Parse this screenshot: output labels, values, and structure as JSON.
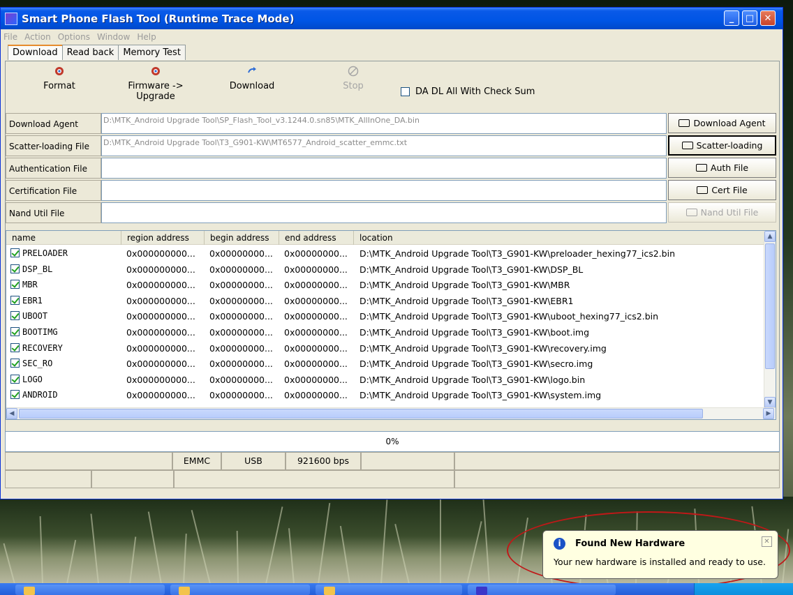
{
  "window": {
    "title": "Smart Phone Flash Tool (Runtime Trace Mode)",
    "controls": {
      "minimize": "_",
      "maximize": "□",
      "close": "✕"
    }
  },
  "menu": [
    "File",
    "Action",
    "Options",
    "Window",
    "Help"
  ],
  "tabs": [
    "Download",
    "Read back",
    "Memory Test"
  ],
  "toolbar": {
    "format": "Format",
    "firmware_upgrade": "Firmware -> Upgrade",
    "download": "Download",
    "stop": "Stop",
    "checksum_label": "DA DL All With Check Sum"
  },
  "files": [
    {
      "label": "Download Agent",
      "value": "D:\\MTK_Android Upgrade Tool\\SP_Flash_Tool_v3.1244.0.sn85\\MTK_AllInOne_DA.bin",
      "button": "Download Agent"
    },
    {
      "label": "Scatter-loading File",
      "value": "D:\\MTK_Android Upgrade Tool\\T3_G901-KW\\MT6577_Android_scatter_emmc.txt",
      "button": "Scatter-loading"
    },
    {
      "label": "Authentication File",
      "value": "",
      "button": "Auth File"
    },
    {
      "label": "Certification File",
      "value": "",
      "button": "Cert File"
    },
    {
      "label": "Nand Util File",
      "value": "",
      "button": "Nand Util File"
    }
  ],
  "list": {
    "headers": [
      "name",
      "region address",
      "begin address",
      "end address",
      "location"
    ],
    "rows": [
      {
        "name": "PRELOADER",
        "region": "0x000000000...",
        "begin": "0x00000000...",
        "end": "0x00000000...",
        "location": "D:\\MTK_Android Upgrade Tool\\T3_G901-KW\\preloader_hexing77_ics2.bin"
      },
      {
        "name": "DSP_BL",
        "region": "0x000000000...",
        "begin": "0x00000000...",
        "end": "0x00000000...",
        "location": "D:\\MTK_Android Upgrade Tool\\T3_G901-KW\\DSP_BL"
      },
      {
        "name": "MBR",
        "region": "0x000000000...",
        "begin": "0x00000000...",
        "end": "0x00000000...",
        "location": "D:\\MTK_Android Upgrade Tool\\T3_G901-KW\\MBR"
      },
      {
        "name": "EBR1",
        "region": "0x000000000...",
        "begin": "0x00000000...",
        "end": "0x00000000...",
        "location": "D:\\MTK_Android Upgrade Tool\\T3_G901-KW\\EBR1"
      },
      {
        "name": "UBOOT",
        "region": "0x000000000...",
        "begin": "0x00000000...",
        "end": "0x00000000...",
        "location": "D:\\MTK_Android Upgrade Tool\\T3_G901-KW\\uboot_hexing77_ics2.bin"
      },
      {
        "name": "BOOTIMG",
        "region": "0x000000000...",
        "begin": "0x00000000...",
        "end": "0x00000000...",
        "location": "D:\\MTK_Android Upgrade Tool\\T3_G901-KW\\boot.img"
      },
      {
        "name": "RECOVERY",
        "region": "0x000000000...",
        "begin": "0x00000000...",
        "end": "0x00000000...",
        "location": "D:\\MTK_Android Upgrade Tool\\T3_G901-KW\\recovery.img"
      },
      {
        "name": "SEC_RO",
        "region": "0x000000000...",
        "begin": "0x00000000...",
        "end": "0x00000000...",
        "location": "D:\\MTK_Android Upgrade Tool\\T3_G901-KW\\secro.img"
      },
      {
        "name": "LOGO",
        "region": "0x000000000...",
        "begin": "0x00000000...",
        "end": "0x00000000...",
        "location": "D:\\MTK_Android Upgrade Tool\\T3_G901-KW\\logo.bin"
      },
      {
        "name": "ANDROID",
        "region": "0x000000000...",
        "begin": "0x00000000...",
        "end": "0x00000000...",
        "location": "D:\\MTK_Android Upgrade Tool\\T3_G901-KW\\system.img"
      }
    ]
  },
  "progress": {
    "text": "0%",
    "value": 0
  },
  "status": {
    "storage": "EMMC",
    "port": "USB",
    "baud": "921600 bps"
  },
  "balloon": {
    "title": "Found New Hardware",
    "text": "Your new hardware is installed and ready to use."
  },
  "icons": {
    "format": "format-icon",
    "firmware_upgrade": "firmware-upgrade-icon",
    "download": "download-icon",
    "stop": "stop-icon",
    "folder": "folder-icon",
    "info": "info-icon",
    "app": "flash-tool-app-icon"
  }
}
